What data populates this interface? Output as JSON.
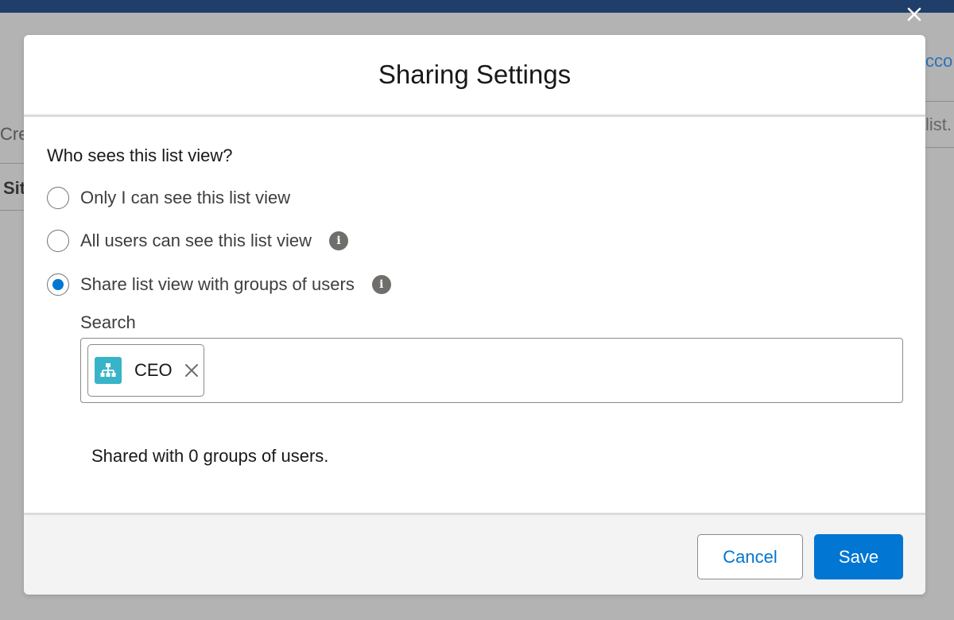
{
  "background": {
    "create_fragment": "Cre",
    "si_fragment": "Sit",
    "acco_fragment": "cco",
    "list_fragment": "list."
  },
  "modal": {
    "title": "Sharing Settings",
    "question": "Who sees this list view?",
    "options": [
      {
        "label": "Only I can see this list view",
        "checked": false,
        "info": false
      },
      {
        "label": "All users can see this list view",
        "checked": false,
        "info": true
      },
      {
        "label": "Share list view with groups of users",
        "checked": true,
        "info": true
      }
    ],
    "search": {
      "label": "Search",
      "pills": [
        {
          "label": "CEO",
          "icon": "hierarchy-icon"
        }
      ]
    },
    "shared_summary": "Shared with 0 groups of users.",
    "footer": {
      "cancel_label": "Cancel",
      "save_label": "Save"
    }
  },
  "colors": {
    "brand": "#0176d3",
    "pill_icon": "#38b4c8",
    "info_icon": "#706e6b"
  }
}
